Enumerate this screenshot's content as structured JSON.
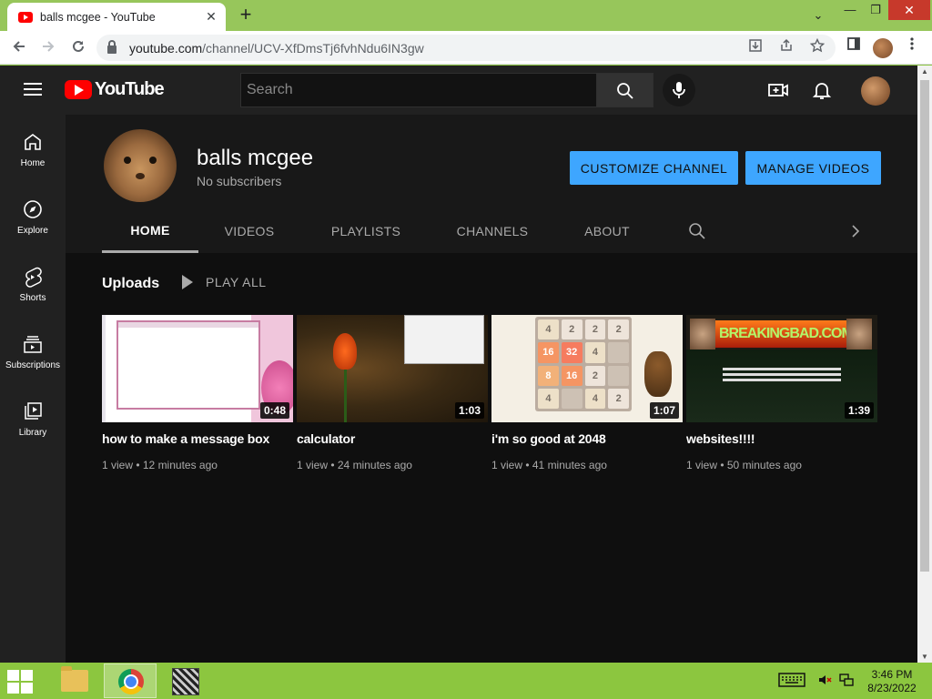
{
  "browser": {
    "tab_title": "balls mcgee - YouTube",
    "tab_close": "✕",
    "new_tab": "+",
    "url_domain": "youtube.com",
    "url_path": "/channel/UCV-XfDmsTj6fvhNdu6IN3gw"
  },
  "window_controls": {
    "chevron": "⌄",
    "minimize": "—",
    "maximize": "❐",
    "close": "✕"
  },
  "youtube": {
    "logo_text": "YouTube",
    "search_placeholder": "Search",
    "accent_color": "#3ea6ff",
    "brand_color": "#ff0000"
  },
  "sidebar": {
    "items": [
      {
        "label": "Home",
        "icon": "home-icon"
      },
      {
        "label": "Explore",
        "icon": "compass-icon"
      },
      {
        "label": "Shorts",
        "icon": "shorts-icon"
      },
      {
        "label": "Subscriptions",
        "icon": "subscriptions-icon"
      },
      {
        "label": "Library",
        "icon": "library-icon"
      }
    ]
  },
  "channel": {
    "name": "balls mcgee",
    "subscribers": "No subscribers",
    "customize_label": "CUSTOMIZE CHANNEL",
    "manage_label": "MANAGE VIDEOS",
    "tabs": [
      "HOME",
      "VIDEOS",
      "PLAYLISTS",
      "CHANNELS",
      "ABOUT"
    ],
    "active_tab": "HOME"
  },
  "uploads": {
    "title": "Uploads",
    "play_all": "PLAY ALL",
    "videos": [
      {
        "title": "how to make a message box",
        "duration": "0:48",
        "meta": "1 view • 12 minutes ago"
      },
      {
        "title": "calculator",
        "duration": "1:03",
        "meta": "1 view • 24 minutes ago"
      },
      {
        "title": "i'm so good at 2048",
        "duration": "1:07",
        "meta": "1 view • 41 minutes ago"
      },
      {
        "title": "websites!!!!",
        "duration": "1:39",
        "meta": "1 view • 50 minutes ago"
      }
    ]
  },
  "game_2048": [
    "4",
    "2",
    "2",
    "2",
    "16",
    "32",
    "4",
    "",
    "8",
    "16",
    "2",
    "",
    "4",
    "",
    "4",
    "2"
  ],
  "thumbnail_banner": "BREAKINGBAD.COM",
  "taskbar": {
    "time": "3:46 PM",
    "date": "8/23/2022"
  }
}
